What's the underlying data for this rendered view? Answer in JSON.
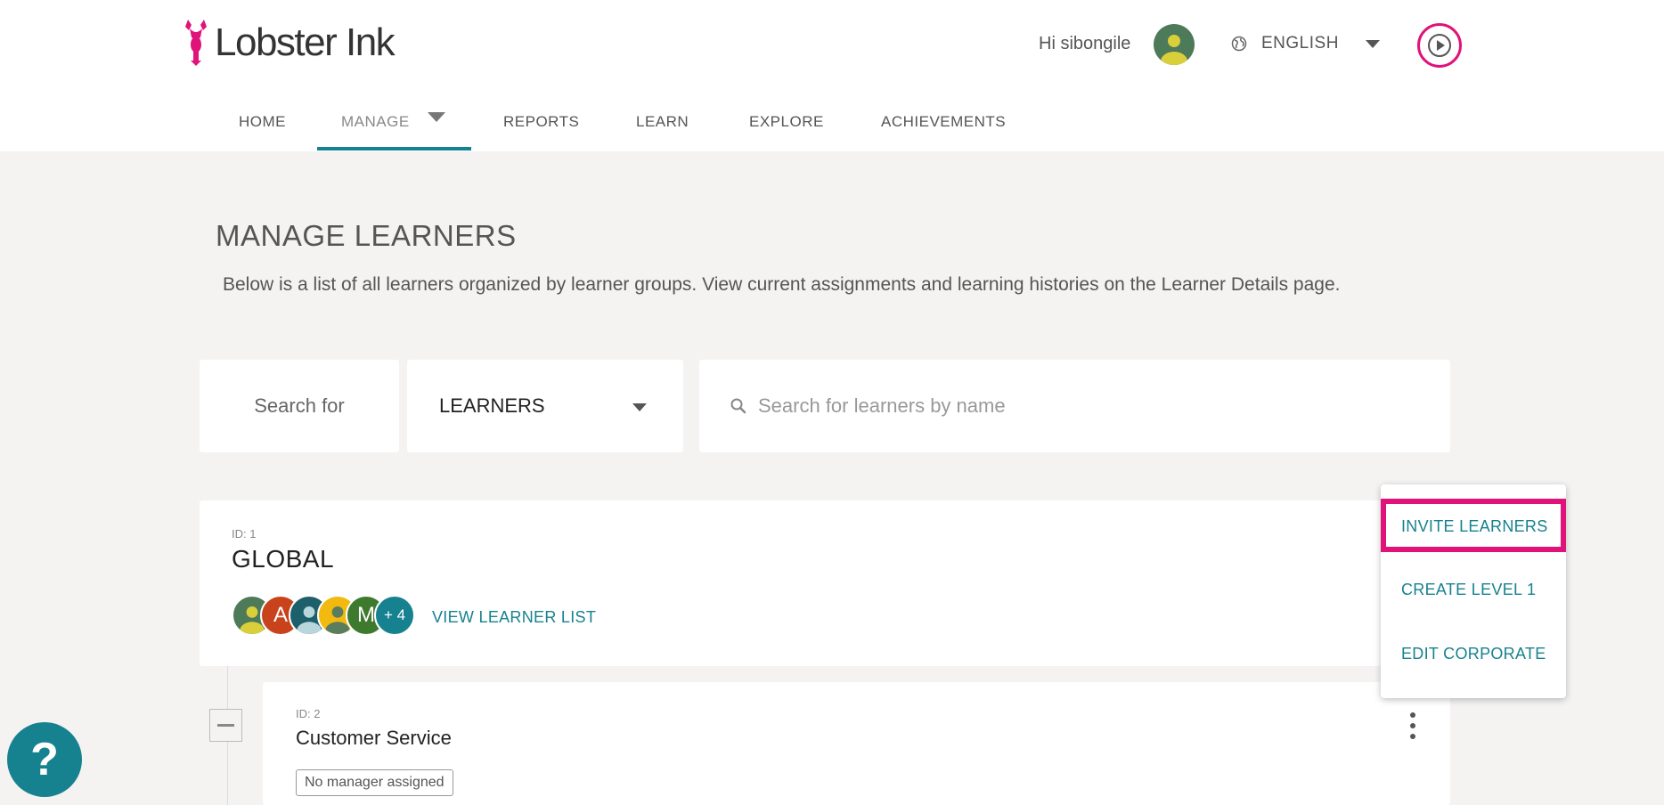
{
  "brand": {
    "name": "Lobster Ink",
    "accent": "#e0137a",
    "teal": "#17828f"
  },
  "header": {
    "greeting": "Hi sibongile",
    "language": "ENGLISH"
  },
  "nav": {
    "items": [
      {
        "label": "HOME"
      },
      {
        "label": "MANAGE",
        "active": true
      },
      {
        "label": "REPORTS"
      },
      {
        "label": "LEARN"
      },
      {
        "label": "EXPLORE"
      },
      {
        "label": "ACHIEVEMENTS"
      }
    ]
  },
  "main": {
    "title": "MANAGE LEARNERS",
    "description": "Below is a list of all learners organized by learner groups. View current assignments and learning histories on the Learner Details page.",
    "search": {
      "label": "Search for",
      "type": "LEARNERS",
      "placeholder": "Search for learners by name"
    },
    "group": {
      "id": "ID: 1",
      "name": "GLOBAL",
      "avatars": [
        {
          "kind": "photo",
          "color": "#4d7a58"
        },
        {
          "kind": "letter",
          "letter": "A",
          "color": "#c8421c"
        },
        {
          "kind": "photo",
          "color": "#1d5f6b"
        },
        {
          "kind": "photo",
          "color": "#f2b90f"
        },
        {
          "kind": "letter",
          "letter": "M",
          "color": "#3d7a2e"
        },
        {
          "kind": "more",
          "letter": "+ 4",
          "color": "#17828f"
        }
      ],
      "view_link": "VIEW LEARNER LIST"
    },
    "subgroup": {
      "id": "ID: 2",
      "name": "Customer Service",
      "manager": "No manager assigned"
    }
  },
  "dropdown": {
    "items": [
      {
        "label": "INVITE LEARNERS",
        "highlighted": true
      },
      {
        "label": "CREATE LEVEL 1"
      },
      {
        "label": "EDIT CORPORATE"
      }
    ]
  },
  "help": {
    "label": "?"
  }
}
